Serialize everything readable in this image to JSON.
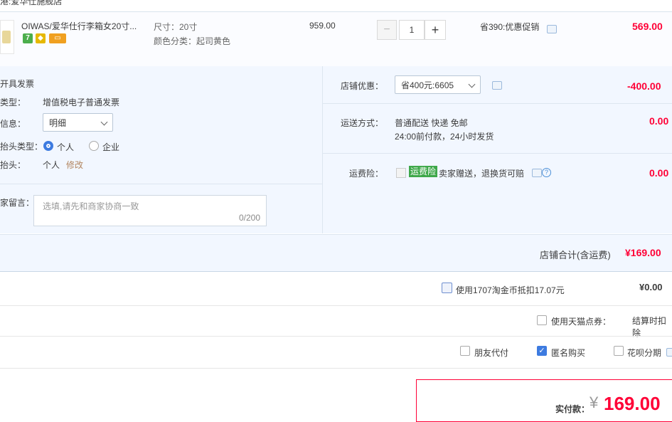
{
  "top_cut": "港:爱华仕施舰店",
  "item": {
    "title": "OIWAS/爱华仕行李箱女20寸...",
    "badge_seven": "7",
    "sku_size": "尺寸：20寸",
    "sku_color": "颜色分类：起司黄色",
    "price": "959.00",
    "qty_minus": "−",
    "quantity": "1",
    "qty_plus": "+",
    "promo": "省390:优惠促销",
    "total": "569.00"
  },
  "invoice": {
    "heading": "开具发票",
    "type_label": "类型：",
    "type_value": "增值税电子普通发票",
    "info_label": "信息：",
    "info_select": "明细",
    "title_type_label": "抬头类型：",
    "radio_personal": "个人",
    "radio_company": "企业",
    "title_label": "抬头：",
    "title_value": "个人",
    "edit": "修改"
  },
  "message": {
    "label": "家留言：",
    "placeholder": "选填,请先和商家协商一致",
    "counter": "0/200"
  },
  "shop_discount": {
    "label": "店铺优惠：",
    "select": "省400元:6605",
    "amount": "-400.00"
  },
  "shipping": {
    "label": "运送方式：",
    "line1": "普通配送 快递 免邮",
    "line2": "24:00前付款，24小时发货",
    "amount": "0.00"
  },
  "insurance": {
    "label": "运费险：",
    "badge": "运费险",
    "text": "卖家赠送，退换货可赔",
    "help": "?",
    "amount": "0.00"
  },
  "store_total": {
    "label": "店铺合计(含运费)",
    "amount": "¥169.00"
  },
  "taobao_coin": {
    "label": "使用1707淘金币抵扣17.07元",
    "amount": "¥0.00"
  },
  "tmall_points": {
    "label": "使用天猫点券：",
    "note": "结算时扣除"
  },
  "options": {
    "friend_pay": "朋友代付",
    "anonymous": "匿名购买",
    "huabei": "花呗分期"
  },
  "pay": {
    "label": "实付款：",
    "currency": "¥",
    "amount": "169.00"
  },
  "colors": {
    "accent_red": "#ff0036",
    "accent_blue": "#3d7be0",
    "panel_bg": "#f2f7ff"
  }
}
